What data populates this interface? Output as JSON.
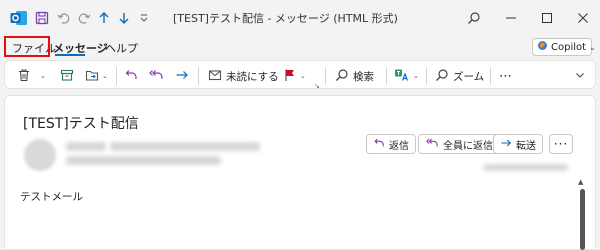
{
  "window": {
    "title": "[TEST]テスト配信  -  メッセージ (HTML 形式)"
  },
  "menu": {
    "file": "ファイル",
    "message": "メッセージ",
    "help": "ヘルプ",
    "copilot": "Copilot"
  },
  "ribbon": {
    "mark_unread": "未読にする",
    "search": "検索",
    "zoom": "ズーム"
  },
  "message": {
    "subject": "[TEST]テスト配信",
    "reply": "返信",
    "reply_all": "全員に返信",
    "forward": "転送",
    "body": "テストメール"
  },
  "colors": {
    "outlook_blue": "#0f6cbd",
    "flag_red": "#c50f1f",
    "reply_purple": "#8a3ea5",
    "forward_blue": "#0f6cbd",
    "highlight_red": "#e01010"
  }
}
